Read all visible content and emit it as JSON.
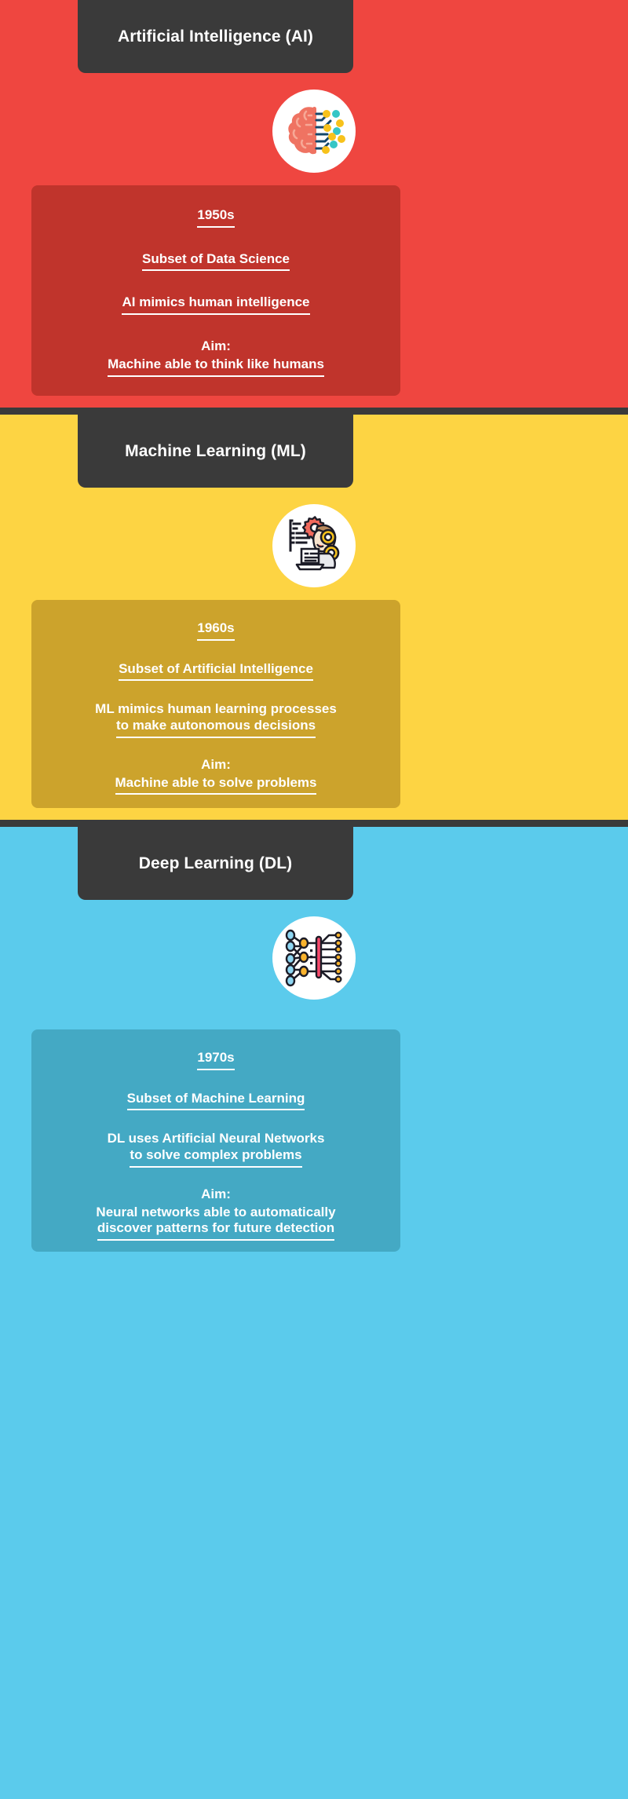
{
  "sections": [
    {
      "id": "ai",
      "title": "Artificial Intelligence (AI)",
      "icon_name": "brain-circuit-icon",
      "bg_color": "#EF4640",
      "panel_color": "#C0342C",
      "decade": "1950s",
      "subset": "Subset of Data Science",
      "description": "AI mimics human intelligence",
      "aim_label": "Aim:",
      "aim_value": "Machine able to think like humans"
    },
    {
      "id": "ml",
      "title": "Machine Learning (ML)",
      "icon_name": "person-laptop-gears-icon",
      "bg_color": "#FDD443",
      "panel_color": "#CCA32C",
      "decade": "1960s",
      "subset": "Subset of Artificial Intelligence",
      "description_line1": "ML mimics human learning processes",
      "description_line2": "to make autonomous decisions",
      "aim_label": "Aim:",
      "aim_value": "Machine able to solve problems"
    },
    {
      "id": "dl",
      "title": "Deep Learning (DL)",
      "icon_name": "neural-network-icon",
      "bg_color": "#5BCBEC",
      "panel_color": "#44A9C4",
      "decade": "1970s",
      "subset": "Subset of Machine Learning",
      "description_line1": "DL uses Artificial Neural Networks",
      "description_line2": "to solve complex problems",
      "aim_label": "Aim:",
      "aim_value_line1": "Neural networks able to automatically",
      "aim_value_line2": "discover patterns for future detection"
    }
  ],
  "divider_color": "#3A3A3A",
  "header_color": "#3A3A3A",
  "text_color": "#FFFFFF"
}
